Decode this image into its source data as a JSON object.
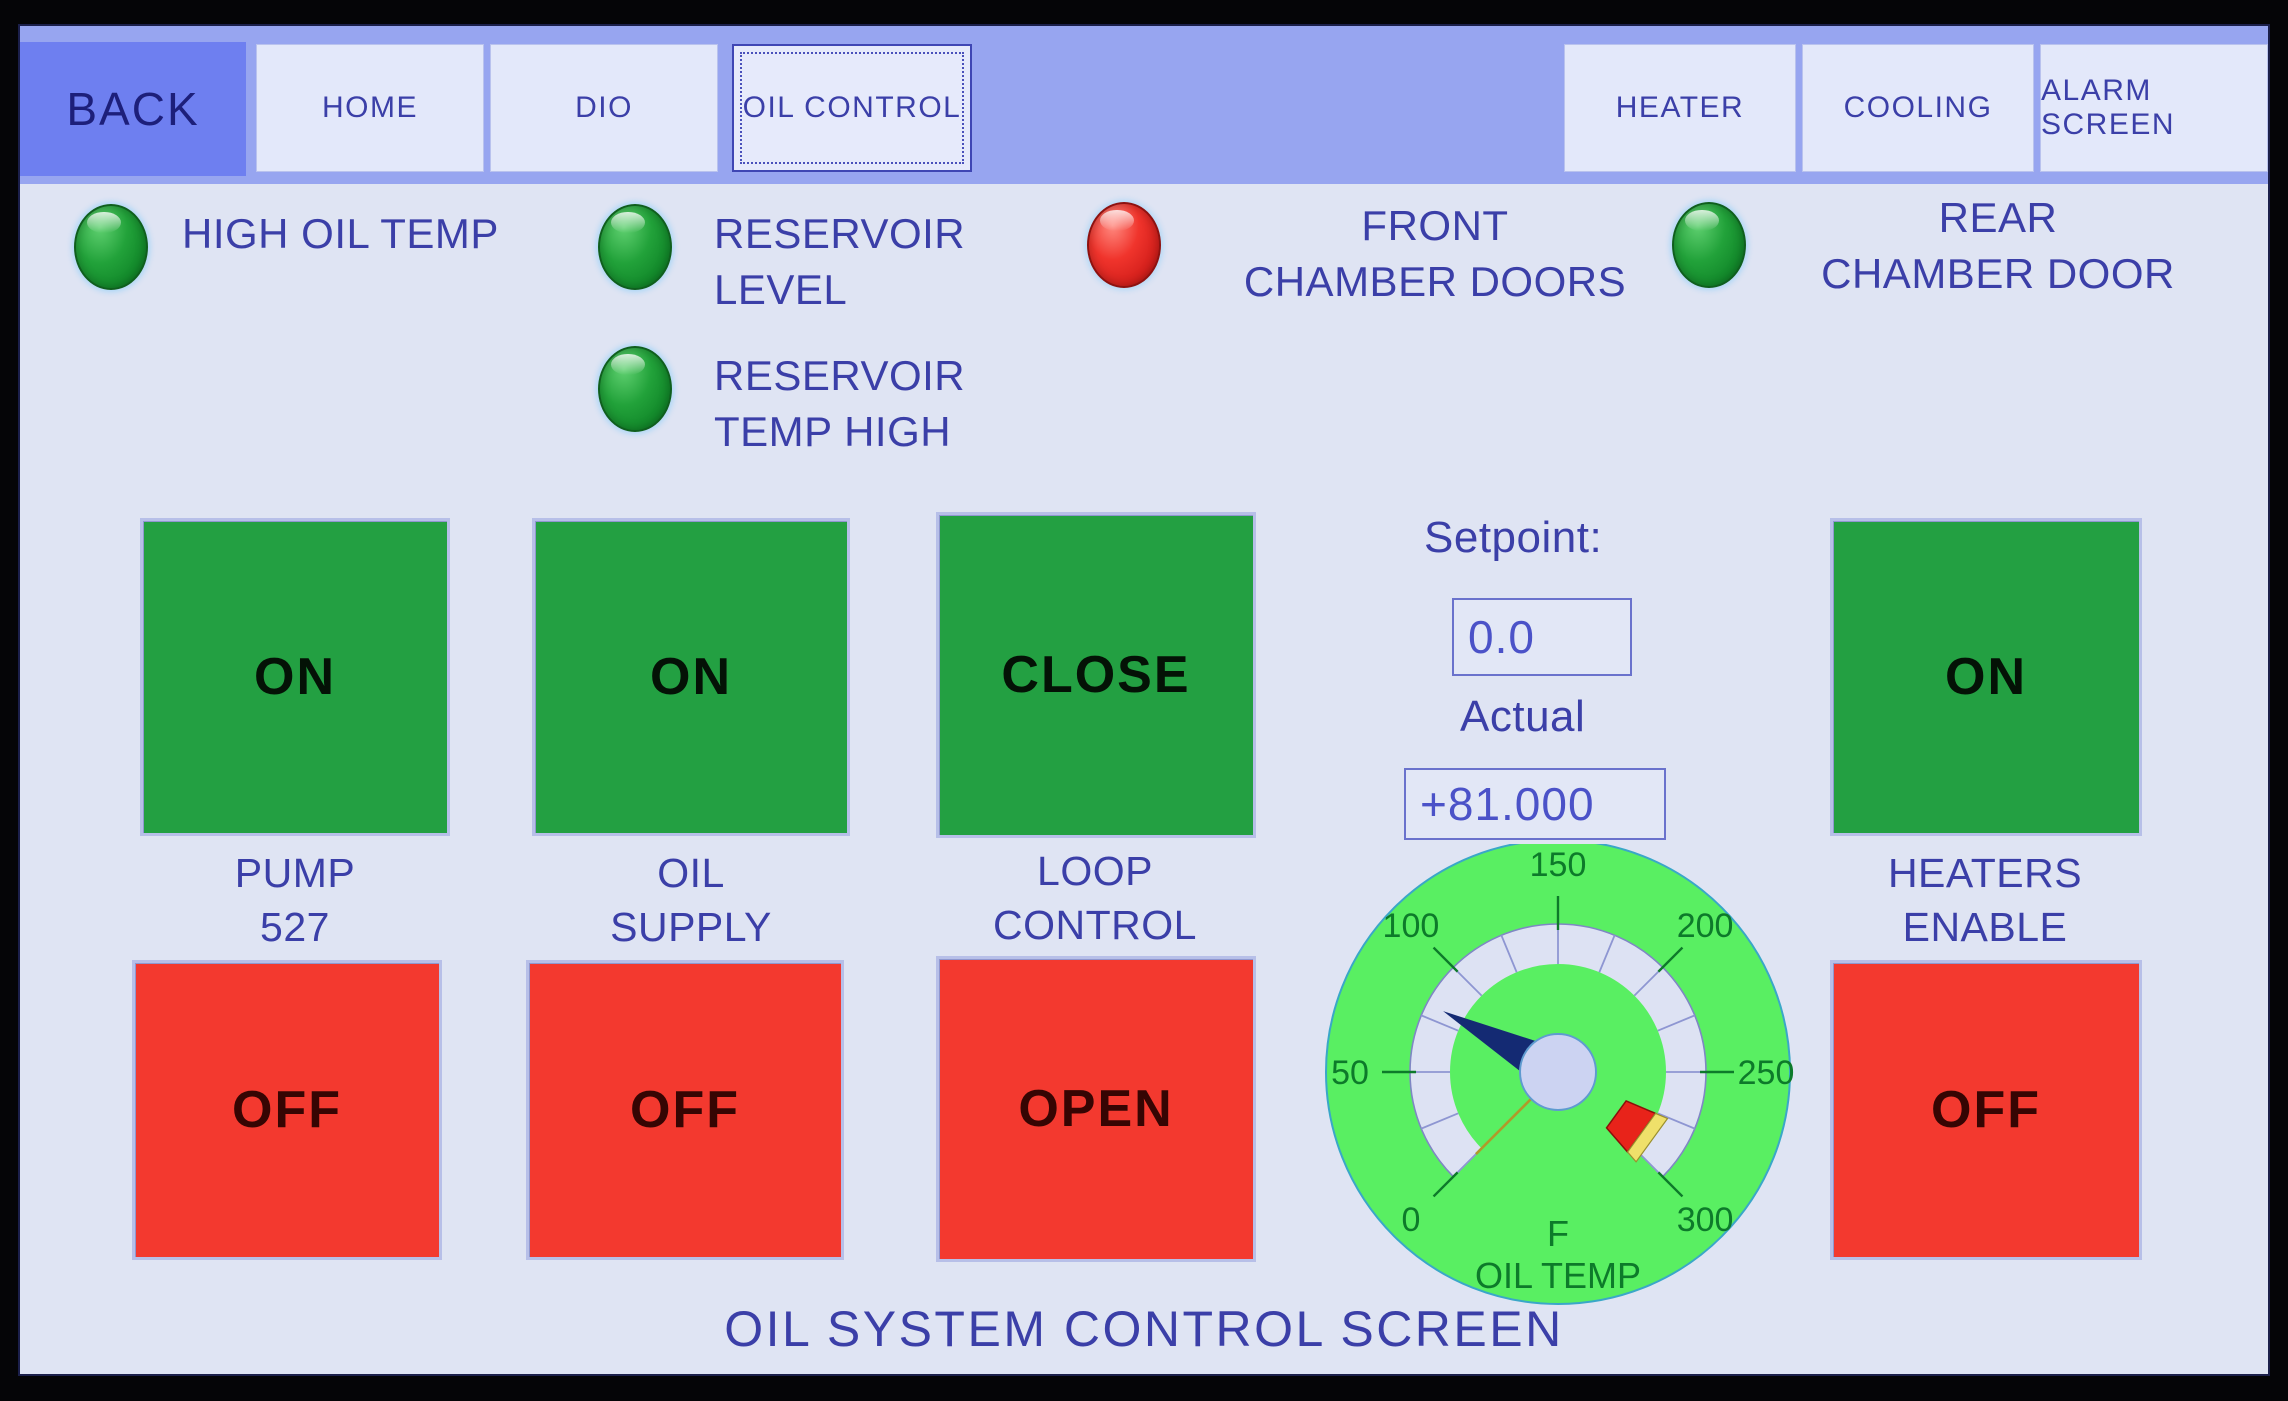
{
  "screen": {
    "title": "OIL SYSTEM CONTROL SCREEN"
  },
  "nav": {
    "back_label": "BACK",
    "tabs": [
      {
        "label": "HOME",
        "active": false
      },
      {
        "label": "DIO",
        "active": false
      },
      {
        "label": "OIL CONTROL",
        "active": true
      },
      {
        "label": "HEATER",
        "active": false
      },
      {
        "label": "COOLING",
        "active": false
      },
      {
        "label": "ALARM SCREEN",
        "active": false
      }
    ]
  },
  "indicators": [
    {
      "label": "HIGH OIL TEMP",
      "state": "green"
    },
    {
      "label": "RESERVOIR\nLEVEL",
      "state": "green"
    },
    {
      "label": "RESERVOIR\nTEMP HIGH",
      "state": "green"
    },
    {
      "label": "FRONT\nCHAMBER DOORS",
      "state": "red"
    },
    {
      "label": "REAR\nCHAMBER DOOR",
      "state": "green"
    }
  ],
  "controls": [
    {
      "name": "pump",
      "label": "PUMP\n527",
      "on_label": "ON",
      "on_state": "green",
      "off_label": "OFF",
      "off_state": "red"
    },
    {
      "name": "oil-supply",
      "label": "OIL\nSUPPLY",
      "on_label": "ON",
      "on_state": "green",
      "off_label": "OFF",
      "off_state": "red"
    },
    {
      "name": "loop-control",
      "label": "LOOP\nCONTROL",
      "on_label": "CLOSE",
      "on_state": "green",
      "off_label": "OPEN",
      "off_state": "red"
    },
    {
      "name": "heaters-enable",
      "label": "HEATERS\nENABLE",
      "on_label": "ON",
      "on_state": "green",
      "off_label": "OFF",
      "off_state": "red"
    }
  ],
  "setpoint": {
    "title": "Setpoint:",
    "value": "0.0",
    "actual_title": "Actual",
    "actual_value": "+81.000"
  },
  "chart_data": {
    "type": "gauge",
    "title": "OIL TEMP",
    "unit": "F",
    "min": 0,
    "max": 300,
    "major_ticks": [
      0,
      50,
      100,
      150,
      200,
      250,
      300
    ],
    "minor_tick_step": 25,
    "start_angle_deg": 225,
    "sweep_deg": 270,
    "needle_value": 81,
    "setpoint_value": 0,
    "alarm_marker_value": 290,
    "face_color": "#59ef62",
    "band_color": "#dde2f3",
    "needle_color": "#142a73",
    "setpoint_pointer_color": "#b09a2a",
    "alarm_marker_color": "#e8231a",
    "label_color": "#0d7a2a"
  }
}
